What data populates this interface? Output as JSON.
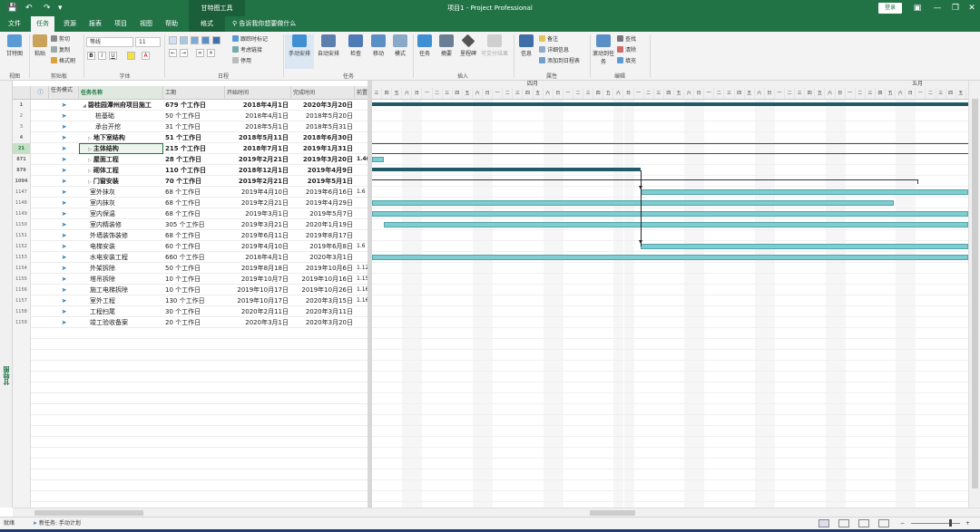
{
  "titlebar": {
    "context_tab": "甘特图工具",
    "doc_title": "项目1  -  Project Professional",
    "login": "登录"
  },
  "tabs": [
    {
      "label": "文件"
    },
    {
      "label": "任务"
    },
    {
      "label": "资源"
    },
    {
      "label": "报表"
    },
    {
      "label": "项目"
    },
    {
      "label": "视图"
    },
    {
      "label": "帮助"
    },
    {
      "label": "格式"
    }
  ],
  "tell_me": "告诉我你想要做什么",
  "ribbon": {
    "view": {
      "gantt": "甘特图",
      "group": "视图"
    },
    "clipboard": {
      "paste": "粘贴",
      "cut": "剪切",
      "copy": "复制",
      "format_painter": "格式刷",
      "group": "剪贴板"
    },
    "font": {
      "name": "等线",
      "size": "11",
      "bold": "B",
      "italic": "I",
      "underline": "U",
      "group": "字体"
    },
    "schedule": {
      "mark_on_track": "跟踪时标记",
      "respect_links": "考虑链接",
      "inactivate": "停用",
      "group": "日程"
    },
    "tasks": {
      "manual": "手动安排",
      "auto": "自动安排",
      "inspect": "检查",
      "move": "移动",
      "mode": "模式",
      "group": "任务"
    },
    "insert": {
      "task": "任务",
      "summary": "摘要",
      "milestone": "里程碑",
      "deliverable": "可交付结果",
      "group": "插入"
    },
    "properties": {
      "info": "信息",
      "notes": "备注",
      "details": "详细信息",
      "add_timeline": "添加到日程表",
      "group": "属性"
    },
    "editing": {
      "scroll": "滚动到任务",
      "find": "查找",
      "clear": "清除",
      "fill": "填充",
      "group": "编辑"
    }
  },
  "columns": {
    "mode": "任务模式",
    "name": "任务名称",
    "duration": "工期",
    "start": "开始时间",
    "finish": "完成时间",
    "pred": "前置"
  },
  "rows": [
    {
      "id": "1",
      "name": "碧桂园潭州府项目施工",
      "duration": "679 个工作日",
      "start": "2018年4月1日",
      "finish": "2020年3月20日",
      "pred": "",
      "bold": true,
      "indent": 0,
      "arrow": "◢"
    },
    {
      "id": "2",
      "name": "桩基础",
      "duration": "50 个工作日",
      "start": "2018年4月1日",
      "finish": "2018年5月20日",
      "pred": "",
      "bold": false,
      "indent": 2,
      "arrow": ""
    },
    {
      "id": "3",
      "name": "承台开挖",
      "duration": "31 个工作日",
      "start": "2018年5月1日",
      "finish": "2018年5月31日",
      "pred": "",
      "bold": false,
      "indent": 2,
      "arrow": ""
    },
    {
      "id": "4",
      "name": "地下室结构",
      "duration": "51 个工作日",
      "start": "2018年5月11日",
      "finish": "2018年6月30日",
      "pred": "",
      "bold": true,
      "indent": 1,
      "arrow": "▷"
    },
    {
      "id": "21",
      "name": "主体结构",
      "duration": "215 个工作日",
      "start": "2018年7月1日",
      "finish": "2019年1月31日",
      "pred": "",
      "bold": true,
      "indent": 1,
      "arrow": "▷",
      "selected": true
    },
    {
      "id": "871",
      "name": "屋面工程",
      "duration": "28 个工作日",
      "start": "2019年2月21日",
      "finish": "2019年3月20日",
      "pred": "1.4(",
      "bold": true,
      "indent": 1,
      "arrow": "▷"
    },
    {
      "id": "879",
      "name": "砌体工程",
      "duration": "110 个工作日",
      "start": "2018年12月1日",
      "finish": "2019年4月9日",
      "pred": "",
      "bold": true,
      "indent": 1,
      "arrow": "▷"
    },
    {
      "id": "1094",
      "name": "门窗安装",
      "duration": "70 个工作日",
      "start": "2019年2月21日",
      "finish": "2019年5月1日",
      "pred": "",
      "bold": true,
      "indent": 1,
      "arrow": "▷"
    },
    {
      "id": "1147",
      "name": "室外抹灰",
      "duration": "68 个工作日",
      "start": "2019年4月10日",
      "finish": "2019年6月16日",
      "pred": "1.6",
      "bold": false,
      "indent": 1,
      "arrow": ""
    },
    {
      "id": "1148",
      "name": "室内抹灰",
      "duration": "68 个工作日",
      "start": "2019年2月21日",
      "finish": "2019年4月29日",
      "pred": "",
      "bold": false,
      "indent": 1,
      "arrow": ""
    },
    {
      "id": "1149",
      "name": "室内保温",
      "duration": "68 个工作日",
      "start": "2019年3月1日",
      "finish": "2019年5月7日",
      "pred": "",
      "bold": false,
      "indent": 1,
      "arrow": ""
    },
    {
      "id": "1150",
      "name": "室内精装修",
      "duration": "305 个工作日",
      "start": "2019年3月21日",
      "finish": "2020年1月19日",
      "pred": "",
      "bold": false,
      "indent": 1,
      "arrow": ""
    },
    {
      "id": "1151",
      "name": "外墙装饰装修",
      "duration": "68 个工作日",
      "start": "2019年6月11日",
      "finish": "2019年8月17日",
      "pred": "",
      "bold": false,
      "indent": 1,
      "arrow": ""
    },
    {
      "id": "1152",
      "name": "电梯安装",
      "duration": "60 个工作日",
      "start": "2019年4月10日",
      "finish": "2019年6月8日",
      "pred": "1.6",
      "bold": false,
      "indent": 1,
      "arrow": ""
    },
    {
      "id": "1153",
      "name": "水电安装工程",
      "duration": "660 个工作日",
      "start": "2018年4月1日",
      "finish": "2020年3月1日",
      "pred": "",
      "bold": false,
      "indent": 1,
      "arrow": ""
    },
    {
      "id": "1154",
      "name": "外架拆除",
      "duration": "50 个工作日",
      "start": "2019年8月18日",
      "finish": "2019年10月6日",
      "pred": "1.12",
      "bold": false,
      "indent": 1,
      "arrow": ""
    },
    {
      "id": "1155",
      "name": "塔吊拆除",
      "duration": "10 个工作日",
      "start": "2019年10月7日",
      "finish": "2019年10月16日",
      "pred": "1.15",
      "bold": false,
      "indent": 1,
      "arrow": ""
    },
    {
      "id": "1156",
      "name": "施工电梯拆除",
      "duration": "10 个工作日",
      "start": "2019年10月17日",
      "finish": "2019年10月26日",
      "pred": "1.16",
      "bold": false,
      "indent": 1,
      "arrow": ""
    },
    {
      "id": "1157",
      "name": "室外工程",
      "duration": "130 个工作日",
      "start": "2019年10月17日",
      "finish": "2020年3月15日",
      "pred": "1.16",
      "bold": false,
      "indent": 1,
      "arrow": ""
    },
    {
      "id": "1158",
      "name": "工程扫尾",
      "duration": "30 个工作日",
      "start": "2020年2月11日",
      "finish": "2020年3月11日",
      "pred": "",
      "bold": false,
      "indent": 1,
      "arrow": ""
    },
    {
      "id": "1159",
      "name": "竣工验收备案",
      "duration": "20 个工作日",
      "start": "2020年3月1日",
      "finish": "2020年3月20日",
      "pred": "",
      "bold": false,
      "indent": 1,
      "arrow": ""
    }
  ],
  "gantt": {
    "months": [
      {
        "label": "四月",
        "pos": 0.26
      },
      {
        "label": "五月",
        "pos": 0.905
      }
    ],
    "days": [
      "三",
      "四",
      "五",
      "六",
      "日",
      "一",
      "二",
      "三",
      "四",
      "五",
      "六",
      "日",
      "一",
      "二",
      "三",
      "四",
      "五",
      "六",
      "日",
      "一",
      "二",
      "三",
      "四",
      "五",
      "六",
      "日",
      "一",
      "二",
      "三",
      "四",
      "五",
      "六",
      "日",
      "一",
      "二",
      "三",
      "四",
      "五",
      "六",
      "日",
      "一",
      "二",
      "三",
      "四",
      "五",
      "六",
      "日",
      "一",
      "二",
      "三",
      "四",
      "五",
      "六",
      "日",
      "一",
      "二",
      "三",
      "四",
      "五"
    ],
    "bars": [
      {
        "row": 0,
        "kind": "summary",
        "from": 0,
        "to": 1
      },
      {
        "row": 5,
        "kind": "task",
        "from": 0,
        "to": 0.02
      },
      {
        "row": 6,
        "kind": "summary",
        "from": 0,
        "to": 0.45
      },
      {
        "row": 7,
        "kind": "bracket",
        "from": 0,
        "to": 0.917
      },
      {
        "row": 8,
        "kind": "task",
        "from": 0.45,
        "to": 1
      },
      {
        "row": 9,
        "kind": "task",
        "from": 0,
        "to": 0.875
      },
      {
        "row": 10,
        "kind": "task",
        "from": 0,
        "to": 1
      },
      {
        "row": 11,
        "kind": "task",
        "from": 0.02,
        "to": 1
      },
      {
        "row": 13,
        "kind": "task",
        "from": 0.45,
        "to": 1
      },
      {
        "row": 14,
        "kind": "task",
        "from": 0,
        "to": 1
      }
    ],
    "selected_row": 4
  },
  "statusbar": {
    "ready": "就绪",
    "new_tasks": "新任务: 手动计划"
  },
  "side_label": "甘特图"
}
